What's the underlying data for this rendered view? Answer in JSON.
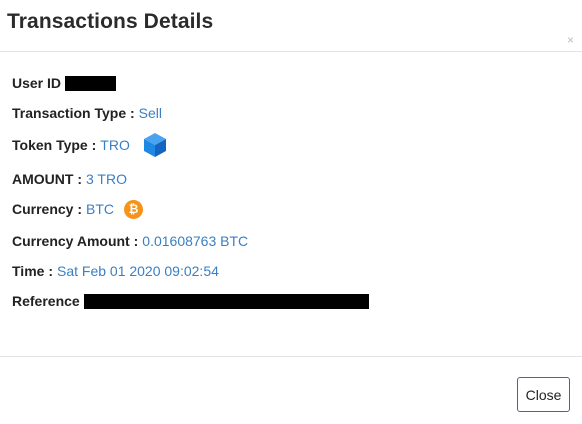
{
  "modal": {
    "title": "Transactions Details",
    "close_symbol": "×"
  },
  "details": {
    "user_id": {
      "label": "User ID"
    },
    "transaction_type": {
      "label": "Transaction Type :",
      "value": "Sell"
    },
    "token_type": {
      "label": "Token Type :",
      "value": "TRO",
      "icon": "cube-icon"
    },
    "amount": {
      "label": "AMOUNT :",
      "value": "3 TRO"
    },
    "currency": {
      "label": "Currency :",
      "value": "BTC",
      "icon": "bitcoin-icon",
      "icon_glyph": "₿"
    },
    "currency_amount": {
      "label": "Currency Amount :",
      "value": "0.01608763 BTC"
    },
    "time": {
      "label": "Time :",
      "value": "Sat Feb 01 2020 09:02:54"
    },
    "reference": {
      "label": "Reference"
    }
  },
  "footer": {
    "close_label": "Close"
  },
  "colors": {
    "value_link": "#3a7fc4",
    "token_icon": "#1e88e5",
    "bitcoin": "#f7931a",
    "button_border": "#2c6fa8"
  }
}
